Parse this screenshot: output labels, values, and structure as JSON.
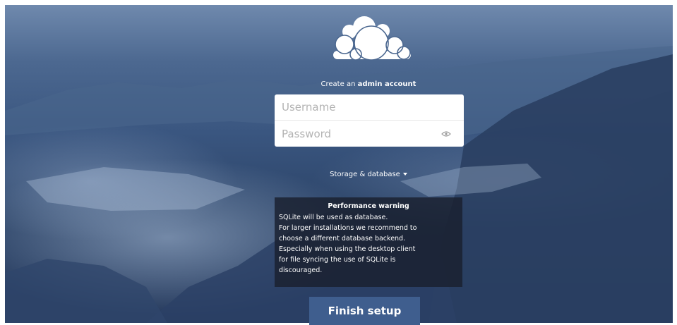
{
  "logo_icon": "owncloud-cloud-logo",
  "intro": {
    "prefix": "Create an ",
    "emphasis": "admin account"
  },
  "login": {
    "username_placeholder": "Username",
    "password_placeholder": "Password",
    "reveal_icon": "eye-icon"
  },
  "storage": {
    "label": "Storage & database",
    "icon": "caret-down-icon"
  },
  "warning": {
    "title": "Performance warning",
    "lines": [
      "SQLite will be used as database.",
      "For larger installations we recommend to",
      "choose a different database backend.",
      "Especially when using the desktop client",
      "for file syncing the use of SQLite is",
      "discouraged."
    ]
  },
  "finish_label": "Finish setup",
  "colors": {
    "background_dark": "#23375a",
    "background_light": "#6f89ad",
    "button": "#3f5e8e",
    "warning_bg": "#1a202e"
  }
}
